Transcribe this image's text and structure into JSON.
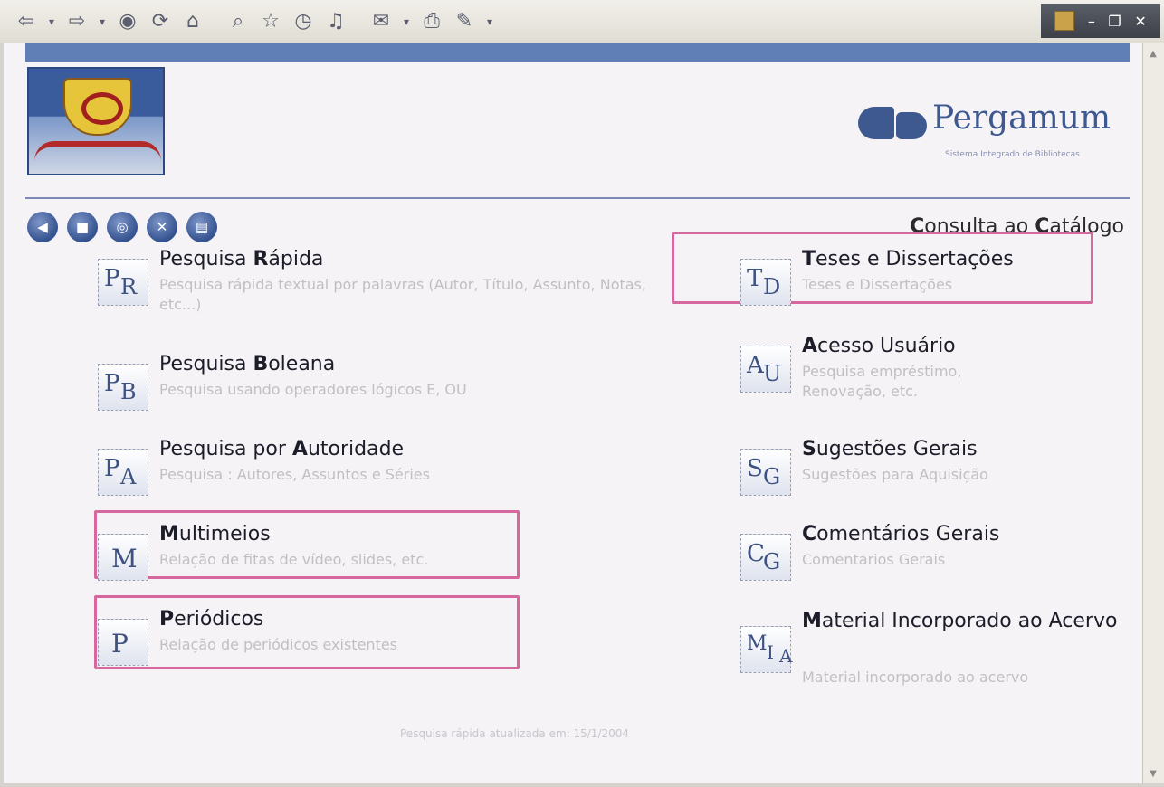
{
  "toolbar": {
    "icons": [
      "back-arrow-icon",
      "dropdown-icon",
      "forward-arrow-icon",
      "dropdown-icon",
      "stop-icon",
      "refresh-icon",
      "home-icon",
      "search-icon",
      "favorites-icon",
      "history-icon",
      "media-icon",
      "mail-icon",
      "print-icon",
      "edit-icon"
    ],
    "window_controls": [
      "minimize",
      "restore",
      "close"
    ]
  },
  "brand": {
    "name": "Pergamum",
    "subtitle": "Sistema Integrado de Bibliotecas"
  },
  "nav": {
    "buttons": [
      "back-icon",
      "home-icon",
      "help-icon",
      "close-icon",
      "print-icon"
    ]
  },
  "section_title": {
    "first_letter_1": "C",
    "rest_1": "onsulta ao ",
    "first_letter_2": "C",
    "rest_2": "atálogo"
  },
  "left_items": [
    {
      "icon_letters": [
        "P",
        "R"
      ],
      "title_pre": "Pesquisa ",
      "title_bold": "R",
      "title_post": "ápida",
      "desc": "Pesquisa rápida textual por palavras (Autor, Título, Assunto, Notas, etc...)"
    },
    {
      "icon_letters": [
        "P",
        "B"
      ],
      "title_pre": "Pesquisa ",
      "title_bold": "B",
      "title_post": "oleana",
      "desc": "Pesquisa usando operadores lógicos E, OU"
    },
    {
      "icon_letters": [
        "P",
        "A"
      ],
      "title_pre": "Pesquisa por ",
      "title_bold": "A",
      "title_post": "utoridade",
      "desc": "Pesquisa : Autores, Assuntos e Séries"
    },
    {
      "icon_letters": [
        "M"
      ],
      "title_pre": "",
      "title_bold": "M",
      "title_post": "ultimeios",
      "desc": "Relação de fitas de vídeo, slides, etc."
    },
    {
      "icon_letters": [
        "P"
      ],
      "title_pre": "",
      "title_bold": "P",
      "title_post": "eriódicos",
      "desc": "Relação de periódicos existentes"
    }
  ],
  "right_items": [
    {
      "icon_letters": [
        "T",
        "D"
      ],
      "title_pre": "",
      "title_bold": "T",
      "title_post": "eses e Dissertações",
      "desc": "Teses e Dissertações"
    },
    {
      "icon_letters": [
        "A",
        "U"
      ],
      "title_pre": "",
      "title_bold": "A",
      "title_post": "cesso Usuário",
      "desc": "Pesquisa empréstimo, Renovação, etc."
    },
    {
      "icon_letters": [
        "S",
        "G"
      ],
      "title_pre": "",
      "title_bold": "S",
      "title_post": "ugestões Gerais",
      "desc": "Sugestões para Aquisição"
    },
    {
      "icon_letters": [
        "C",
        "G"
      ],
      "title_pre": "",
      "title_bold": "C",
      "title_post": "omentários Gerais",
      "desc": "Comentarios Gerais"
    },
    {
      "icon_letters": [
        "M",
        "I",
        "A"
      ],
      "title_pre": "",
      "title_bold": "M",
      "title_post": "aterial Incorporado ao Acervo",
      "desc": "Material incorporado ao acervo"
    }
  ],
  "footer": "Pesquisa rápida atualizada em: 15/1/2004",
  "colors": {
    "accent": "#3e5990",
    "highlight": "#d7689e",
    "description_text": "#c2bfc4"
  }
}
